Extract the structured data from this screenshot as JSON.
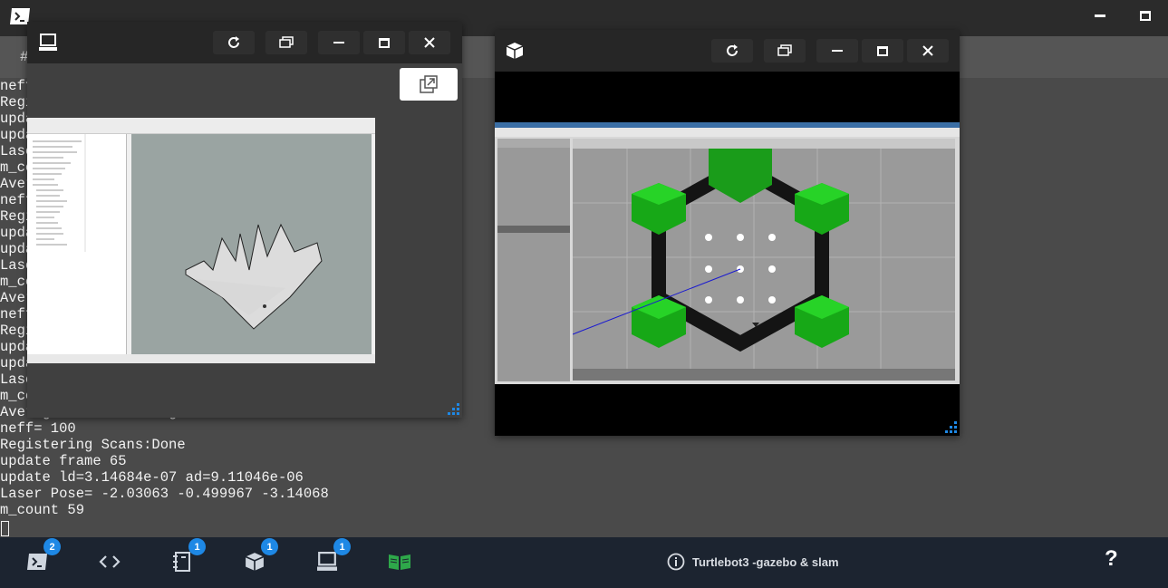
{
  "topbar": {
    "minimize_icon": "minimize-icon",
    "maximize_icon": "maximize-icon"
  },
  "tabstrip": {
    "tab_label": "#"
  },
  "terminal": {
    "lines": [
      "neff= 100",
      "Registering Scans:Done",
      "update frame 64",
      "update ld=3.14684e-07 ad=9.11046e-06",
      "Laser Pose= -2.03063 -0.499967 -3.14068",
      "m_count 58",
      "Average Scan Matching Score=213.372",
      "neff= 100",
      "Registering Scans:Done",
      "update frame 64",
      "update ld=3.14684e-07 ad=9.11046e-06",
      "Laser Pose= -2.03063 -0.499967 -3.14068",
      "m_count 58",
      "Average Scan Matching Score=213.372",
      "neff= 100",
      "Registering Scans:Done",
      "update frame 64",
      "update ld=3.14684e-07 ad=9.11046e-06",
      "Laser Pose= -2.03063 -0.499967 -3.14068",
      "m_count 58",
      "Average Scan Matching Score=213.372",
      "neff= 100",
      "Registering Scans:Done",
      "update frame 65",
      "update ld=3.14684e-07 ad=9.11046e-06",
      "Laser Pose= -2.03063 -0.499967 -3.14068",
      "m_count 59"
    ]
  },
  "rviz_window": {
    "icon": "desktop-icon"
  },
  "gazebo_window": {
    "icon": "cube-icon"
  },
  "dock": {
    "terminal_badge": "2",
    "notebook_badge": "1",
    "gazebo_badge": "1",
    "desktop_badge": "1",
    "title": "Turtlebot3 -gazebo & slam",
    "help": "?"
  },
  "colors": {
    "dock_bg": "#1c2430",
    "badge": "#1e88e5",
    "accent_green": "#2ea84a"
  }
}
